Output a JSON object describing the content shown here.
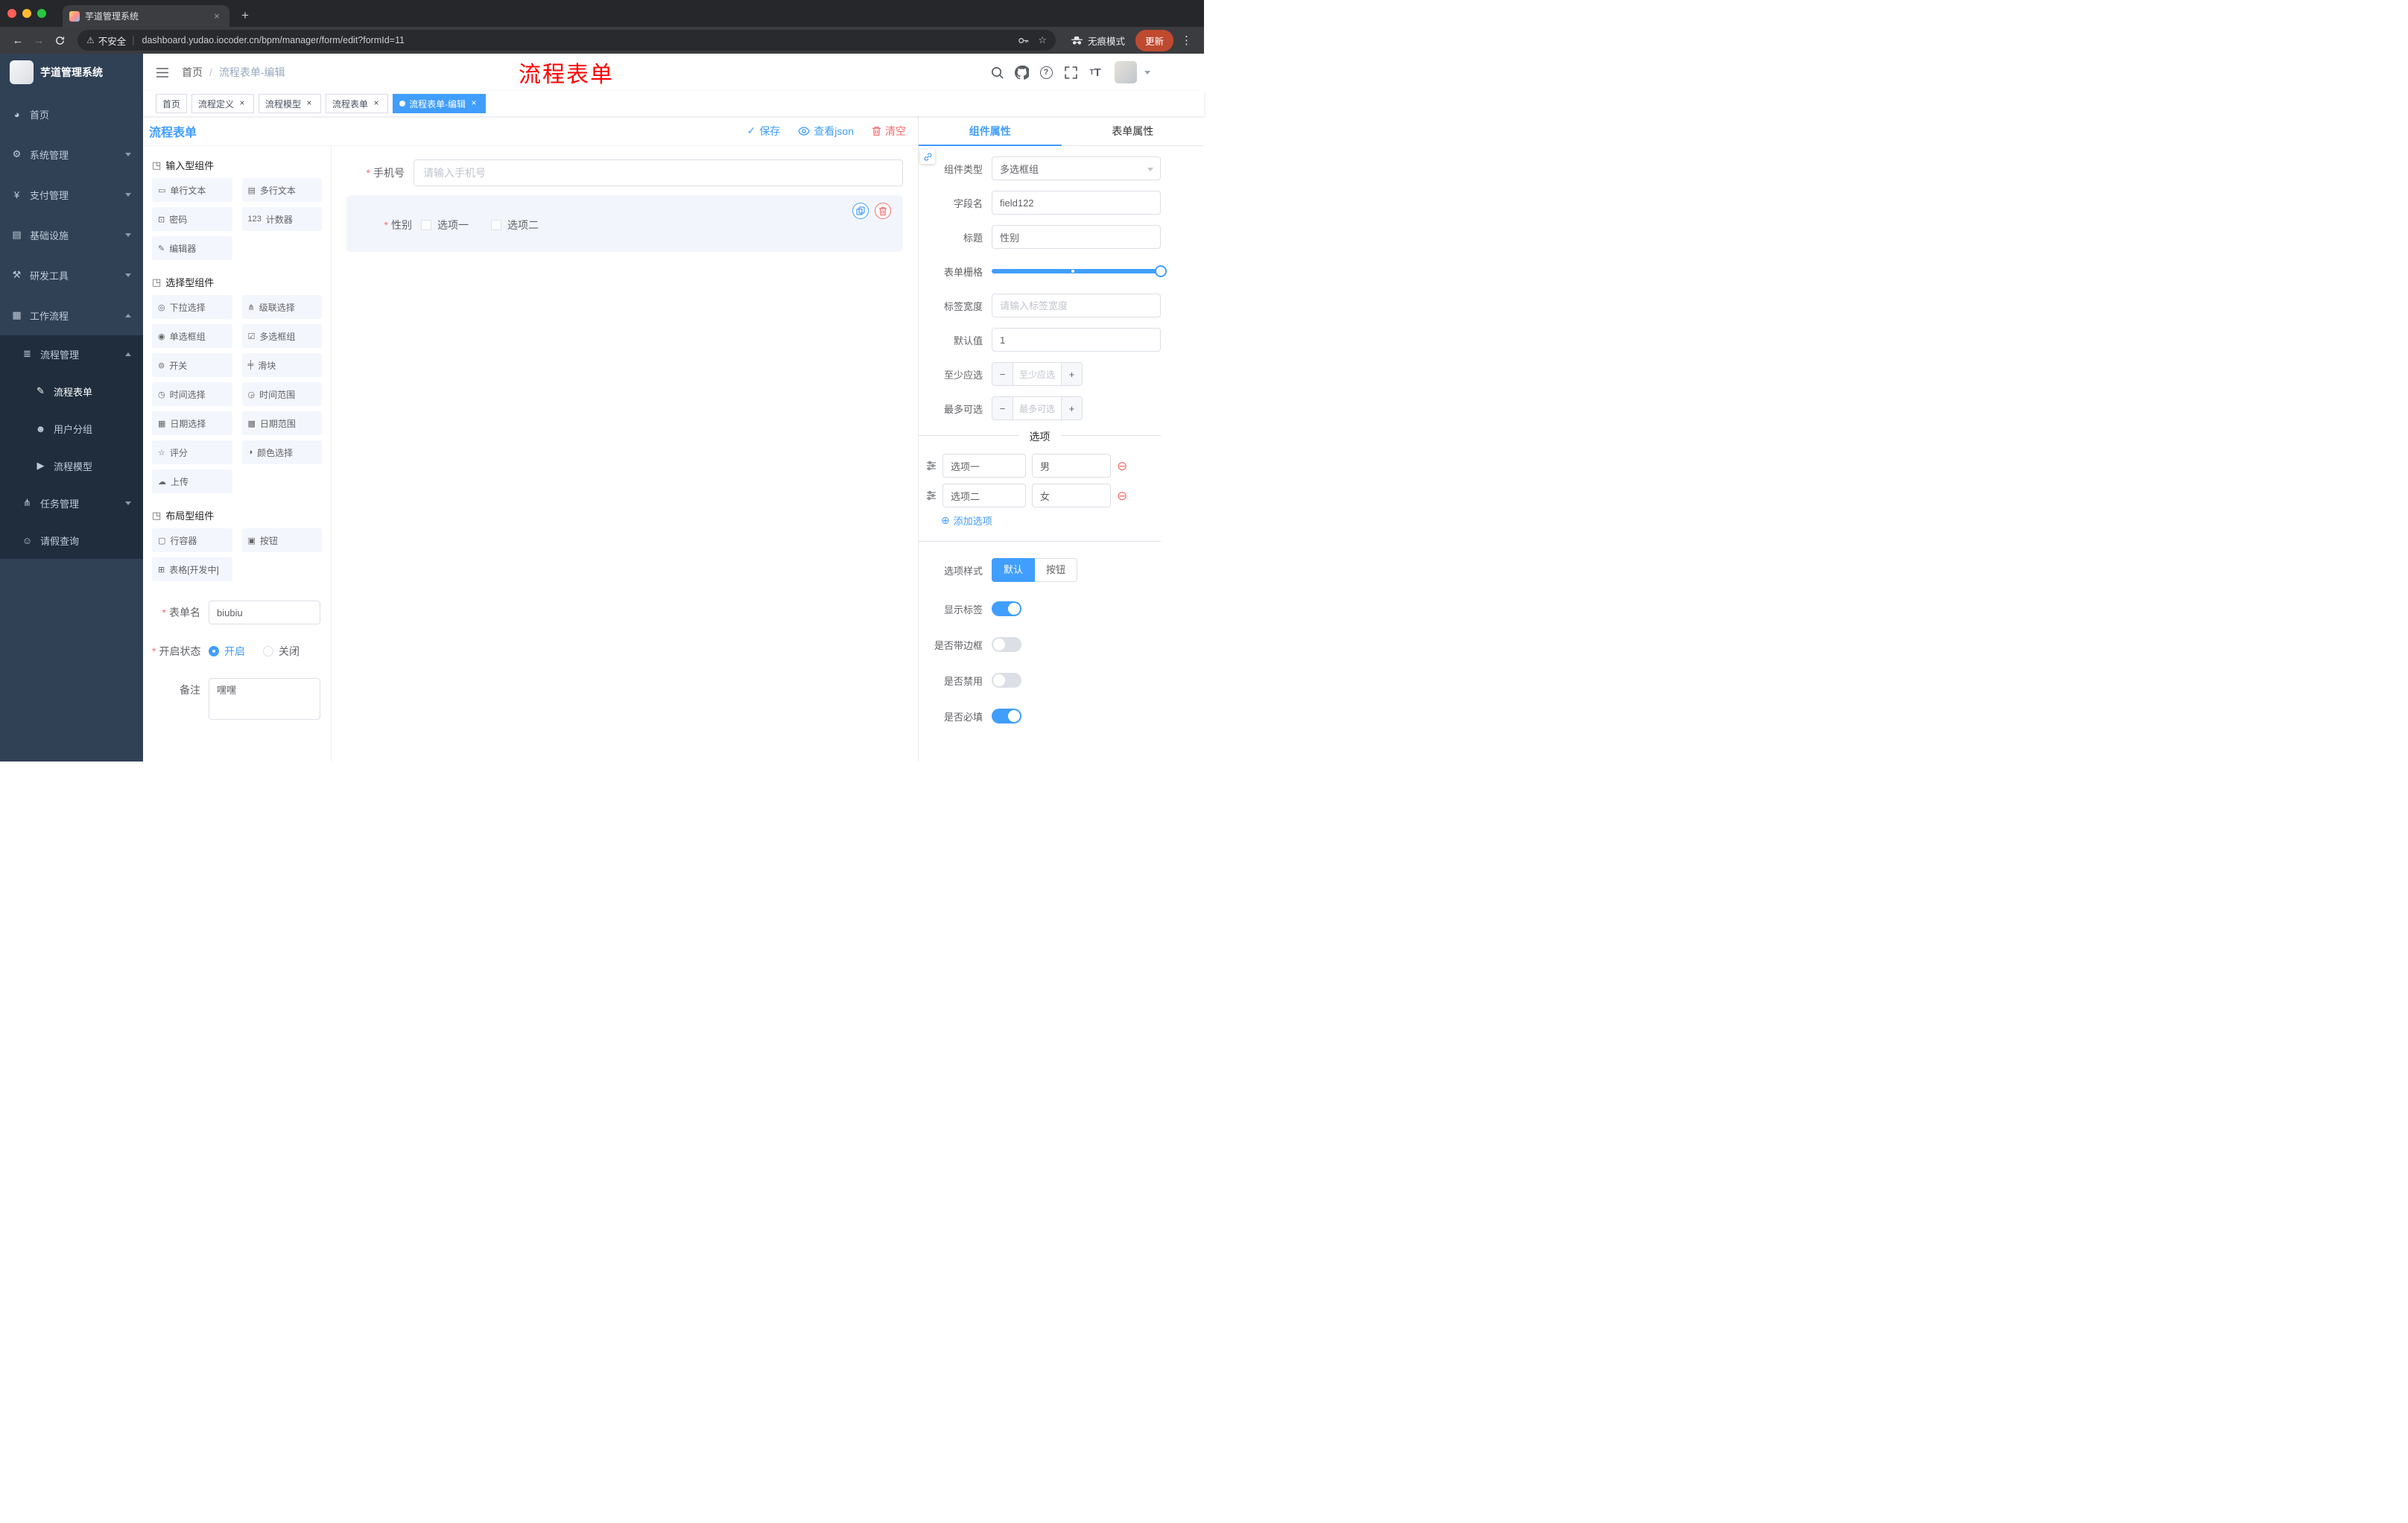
{
  "colors": {
    "primary": "#409eff",
    "danger": "#f56c6c",
    "annotation_red": "#fe0000",
    "sidebar_bg": "#304156",
    "submenu_bg": "#1f2d3d",
    "active_tag_bg": "#409eff",
    "update_pill": "#bf4a30"
  },
  "icons": {
    "close": "×",
    "plus": "+",
    "back": "←",
    "forward": "→",
    "kebab": "⋮",
    "star": "☆",
    "warning": "⚠",
    "divider": "|",
    "slash": "/",
    "check": "✓",
    "add": "⊕",
    "remove": "⊖",
    "minus": "−",
    "question": "?",
    "font_large": "T",
    "font_small": "T",
    "group": "◳"
  },
  "browser": {
    "tab_title": "芋道管理系统",
    "security_label": "不安全",
    "url": "dashboard.yudao.iocoder.cn/bpm/manager/form/edit?formId=11",
    "incognito_label": "无痕模式",
    "update_label": "更新"
  },
  "sidebar": {
    "logo_title": "芋道管理系统",
    "items": [
      {
        "label": "首页",
        "glyph": "◕",
        "icon": "dashboard-icon",
        "level": 0
      },
      {
        "label": "系统管理",
        "glyph": "⚙",
        "icon": "gear-icon",
        "level": 0,
        "chevron": "down"
      },
      {
        "label": "支付管理",
        "glyph": "¥",
        "icon": "yen-icon",
        "level": 0,
        "chevron": "down"
      },
      {
        "label": "基础设施",
        "glyph": "▤",
        "icon": "infra-icon",
        "level": 0,
        "chevron": "down"
      },
      {
        "label": "研发工具",
        "glyph": "⚒",
        "icon": "tools-icon",
        "level": 0,
        "chevron": "down"
      },
      {
        "label": "工作流程",
        "glyph": "▦",
        "icon": "workflow-icon",
        "level": 0,
        "chevron": "up"
      },
      {
        "label": "流程管理",
        "glyph": "≣",
        "icon": "process-manage-icon",
        "level": 1,
        "chevron": "up"
      },
      {
        "label": "流程表单",
        "glyph": "✎",
        "icon": "process-form-icon",
        "level": 2,
        "active": true
      },
      {
        "label": "用户分组",
        "glyph": "☻",
        "icon": "user-group-icon",
        "level": 2
      },
      {
        "label": "流程模型",
        "glyph": "▶",
        "icon": "process-model-icon",
        "level": 2
      },
      {
        "label": "任务管理",
        "glyph": "⋔",
        "icon": "task-manage-icon",
        "level": 1,
        "chevron": "down"
      },
      {
        "label": "请假查询",
        "glyph": "☺",
        "icon": "leave-query-icon",
        "level": 1
      }
    ]
  },
  "header": {
    "breadcrumb": [
      "首页",
      "流程表单-编辑"
    ],
    "annotation": "流程表单"
  },
  "tags": [
    {
      "label": "首页"
    },
    {
      "label": "流程定义",
      "closable": true
    },
    {
      "label": "流程模型",
      "closable": true
    },
    {
      "label": "流程表单",
      "closable": true
    },
    {
      "label": "流程表单-编辑",
      "closable": true,
      "active": true
    }
  ],
  "designer": {
    "title": "流程表单",
    "save_label": "保存",
    "view_json_label": "查看json",
    "clear_label": "清空",
    "groups": [
      {
        "title": "输入型组件",
        "items": [
          {
            "label": "单行文本",
            "glyph": "▭",
            "icon": "single-line-text-icon"
          },
          {
            "label": "多行文本",
            "glyph": "▤",
            "icon": "multi-line-text-icon"
          },
          {
            "label": "密码",
            "glyph": "⊡",
            "icon": "password-icon"
          },
          {
            "label": "计数器",
            "glyph": "123",
            "icon": "counter-icon"
          },
          {
            "label": "编辑器",
            "glyph": "✎",
            "icon": "editor-icon"
          }
        ]
      },
      {
        "title": "选择型组件",
        "items": [
          {
            "label": "下拉选择",
            "glyph": "◎",
            "icon": "select-icon"
          },
          {
            "label": "级联选择",
            "glyph": "⋔",
            "icon": "cascader-icon"
          },
          {
            "label": "单选框组",
            "glyph": "◉",
            "icon": "radio-group-icon"
          },
          {
            "label": "多选框组",
            "glyph": "☑",
            "icon": "checkbox-group-icon"
          },
          {
            "label": "开关",
            "glyph": "⊜",
            "icon": "switch-icon"
          },
          {
            "label": "滑块",
            "glyph": "╪",
            "icon": "slider-icon"
          },
          {
            "label": "时间选择",
            "glyph": "◷",
            "icon": "time-picker-icon"
          },
          {
            "label": "时间范围",
            "glyph": "◶",
            "icon": "time-range-icon"
          },
          {
            "label": "日期选择",
            "glyph": "▦",
            "icon": "date-picker-icon"
          },
          {
            "label": "日期范围",
            "glyph": "▩",
            "icon": "date-range-icon"
          },
          {
            "label": "评分",
            "glyph": "☆",
            "icon": "rate-icon"
          },
          {
            "label": "颜色选择",
            "glyph": "◑",
            "icon": "color-picker-icon"
          },
          {
            "label": "上传",
            "glyph": "☁",
            "icon": "upload-icon"
          }
        ]
      },
      {
        "title": "布局型组件",
        "items": [
          {
            "label": "行容器",
            "glyph": "▢",
            "icon": "row-container-icon"
          },
          {
            "label": "按钮",
            "glyph": "▣",
            "icon": "button-icon"
          },
          {
            "label": "表格[开发中]",
            "glyph": "⊞",
            "icon": "table-icon"
          }
        ]
      }
    ],
    "meta": {
      "form_name_label": "表单名",
      "form_name_value": "biubiu",
      "status_label": "开启状态",
      "status_on": "开启",
      "status_off": "关闭",
      "remark_label": "备注",
      "remark_value": "嘿嘿"
    },
    "canvas": {
      "phone_label": "手机号",
      "phone_placeholder": "请输入手机号",
      "gender_label": "性别",
      "gender_options": [
        "选项一",
        "选项二"
      ]
    }
  },
  "props": {
    "tab_component": "组件属性",
    "tab_form": "表单属性",
    "rows": {
      "type_label": "组件类型",
      "type_value": "多选框组",
      "field_label": "字段名",
      "field_value": "field122",
      "title_label": "标题",
      "title_value": "性别",
      "grid_label": "表单栅格",
      "width_label": "标签宽度",
      "width_placeholder": "请输入标签宽度",
      "default_label": "默认值",
      "default_value": "1",
      "min_label": "至少应选",
      "min_placeholder": "至少应选",
      "max_label": "最多可选",
      "max_placeholder": "最多可选"
    },
    "options_divider": "选项",
    "options": [
      {
        "label": "选项一",
        "value": "男"
      },
      {
        "label": "选项二",
        "value": "女"
      }
    ],
    "add_option": "添加选项",
    "style_label": "选项样式",
    "style_default": "默认",
    "style_button": "按钮",
    "switches": [
      {
        "label": "显示标签",
        "on": true,
        "name": "show-label-switch"
      },
      {
        "label": "是否带边框",
        "on": false,
        "name": "with-border-switch"
      },
      {
        "label": "是否禁用",
        "on": false,
        "name": "disabled-switch"
      },
      {
        "label": "是否必填",
        "on": true,
        "name": "required-switch"
      }
    ]
  }
}
